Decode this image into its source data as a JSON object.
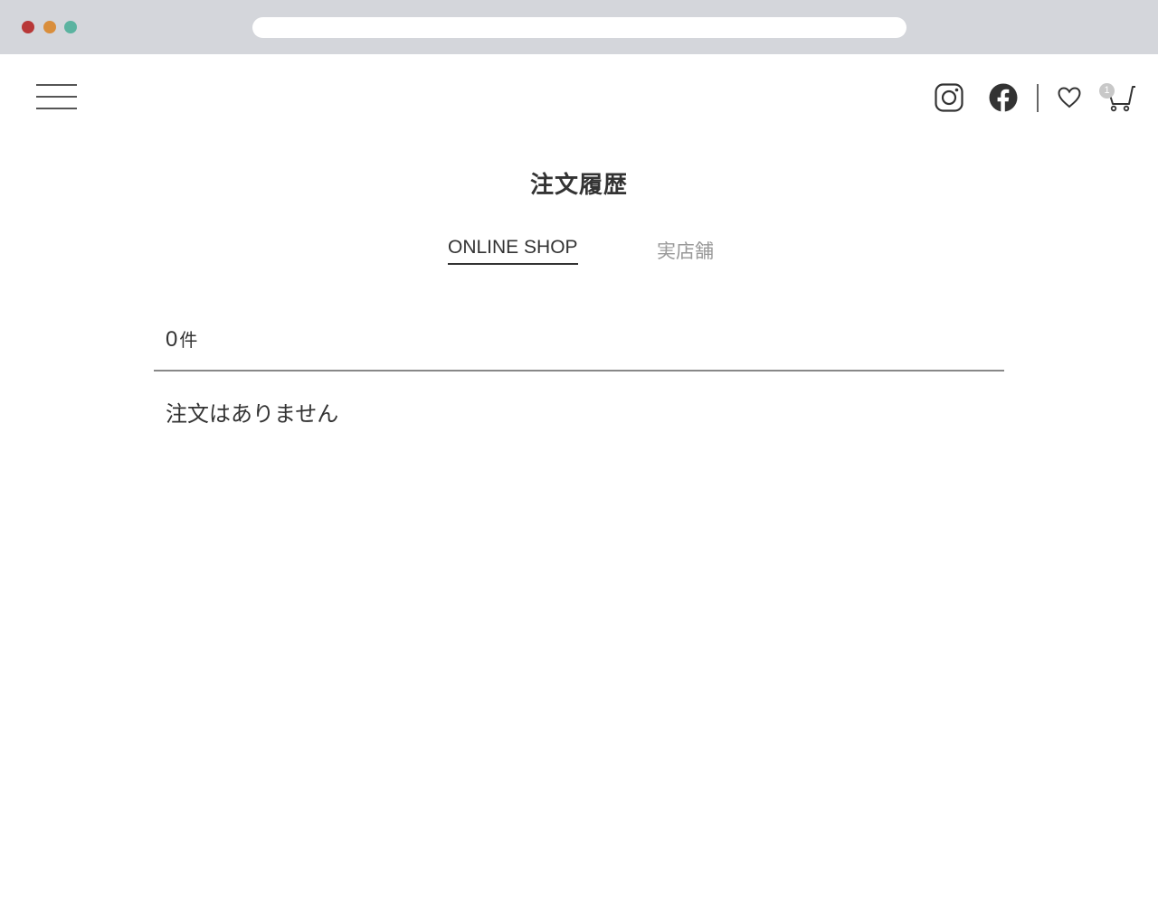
{
  "header": {
    "menu_icon": "hamburger-menu-icon",
    "social_icons": [
      "instagram-icon",
      "facebook-icon"
    ],
    "wishlist_icon": "heart-icon",
    "cart_icon": "cart-icon",
    "cart_badge_count": "1"
  },
  "page": {
    "title": "注文履歴"
  },
  "tabs": [
    {
      "label": "ONLINE SHOP",
      "active": true
    },
    {
      "label": "実店舗",
      "active": false
    }
  ],
  "orders": {
    "count": "0",
    "count_unit": "件",
    "empty_message": "注文はありません"
  },
  "colors": {
    "browser_chrome": "#d4d6db",
    "text_primary": "#333333",
    "text_muted": "#999999",
    "dot_red": "#b83838",
    "dot_orange": "#d98e3c",
    "dot_green": "#5bb3a0"
  }
}
